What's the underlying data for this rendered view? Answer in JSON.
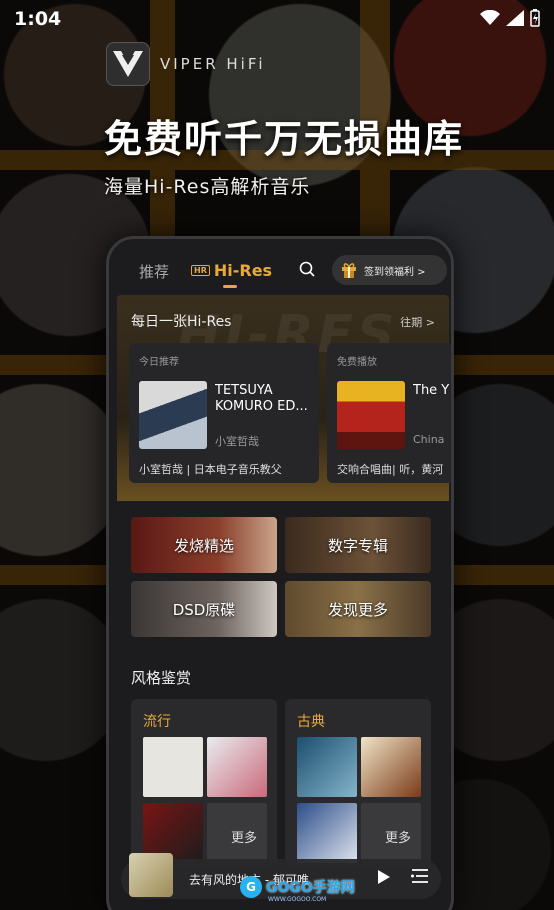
{
  "status": {
    "time": "1:04"
  },
  "app": {
    "logo_text": "VIPER HiFi"
  },
  "hero": {
    "headline": "免费听千万无损曲库",
    "subline": "海量Hi-Res高解析音乐"
  },
  "tabs": {
    "recommend": "推荐",
    "hires": "Hi-Res",
    "hires_badge": "HR"
  },
  "signin": {
    "label": "签到领福利 >"
  },
  "daily": {
    "title": "每日一张Hi-Res",
    "watermark": "HI-RES",
    "more": "往期 >",
    "cards": [
      {
        "label": "今日推荐",
        "title": "TETSUYA KOMURO ED...",
        "artist": "小室哲哉",
        "desc": "小室哲哉 | 日本电子音乐教父"
      },
      {
        "label": "免费播放",
        "title": "The Y River",
        "artist": "China",
        "desc": "交响合唱曲| 听，黄河"
      }
    ]
  },
  "tiles": [
    "发烧精选",
    "数字专辑",
    "DSD原碟",
    "发现更多"
  ],
  "styles": {
    "title": "风格鉴赏",
    "genres": [
      {
        "name": "流行",
        "more": "更多"
      },
      {
        "name": "古典",
        "more": "更多"
      }
    ]
  },
  "player": {
    "song": "去有风的地方 - 郁可唯"
  },
  "watermark": {
    "brand": "GOGO手游网",
    "logo_letter": "G",
    "url": "WWW.GOGOO.COM"
  },
  "colors": {
    "accent": "#e7a93a",
    "background": "#1c1c1e"
  }
}
